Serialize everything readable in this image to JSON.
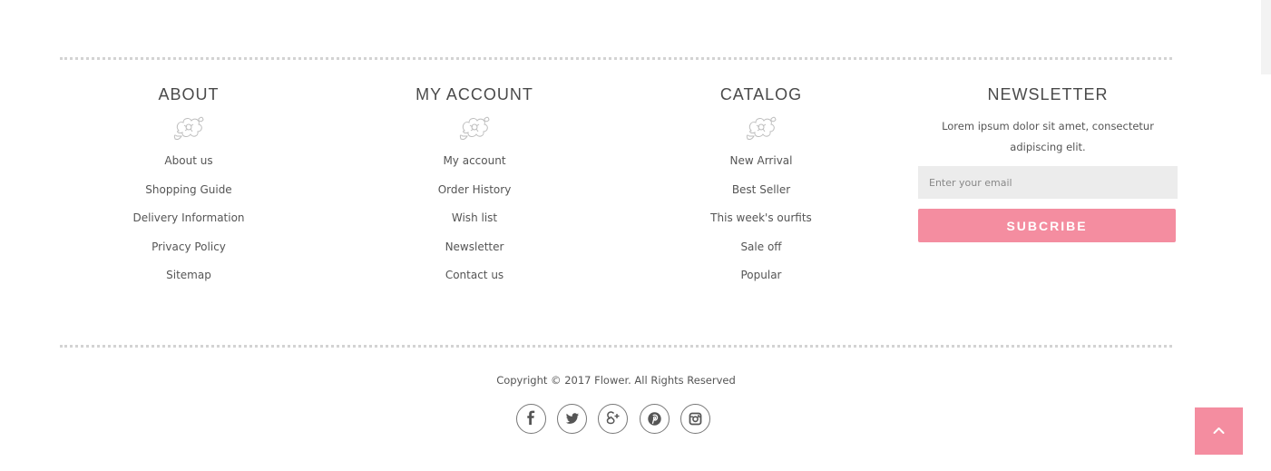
{
  "theme": {
    "accent": "#f48da0",
    "text": "#555555",
    "divider": "#d3d3d3",
    "input_bg": "#ececec"
  },
  "footer": {
    "columns": [
      {
        "title": "ABOUT",
        "icon": "flower-icon",
        "links": [
          "About us",
          "Shopping Guide",
          "Delivery Information",
          "Privacy Policy",
          "Sitemap"
        ]
      },
      {
        "title": "MY ACCOUNT",
        "icon": "flower-icon",
        "links": [
          "My account",
          "Order History",
          "Wish list",
          "Newsletter",
          "Contact us"
        ]
      },
      {
        "title": "CATALOG",
        "icon": "flower-icon",
        "links": [
          "New Arrival",
          "Best Seller",
          "This week's ourfits",
          "Sale off",
          "Popular"
        ]
      }
    ],
    "newsletter": {
      "title": "NEWSLETTER",
      "description": "Lorem ipsum dolor sit amet, consectetur adipiscing elit.",
      "email_placeholder": "Enter your email",
      "email_value": "",
      "button_label": "SUBCRIBE"
    },
    "copyright": "Copyright © 2017 Flower. All Rights Reserved",
    "social": [
      {
        "name": "facebook",
        "icon": "facebook-icon"
      },
      {
        "name": "twitter",
        "icon": "twitter-icon"
      },
      {
        "name": "google-plus",
        "icon": "google-plus-icon"
      },
      {
        "name": "pinterest",
        "icon": "pinterest-icon"
      },
      {
        "name": "instagram",
        "icon": "instagram-icon"
      }
    ],
    "back_to_top": {
      "icon": "chevron-up-icon"
    }
  }
}
